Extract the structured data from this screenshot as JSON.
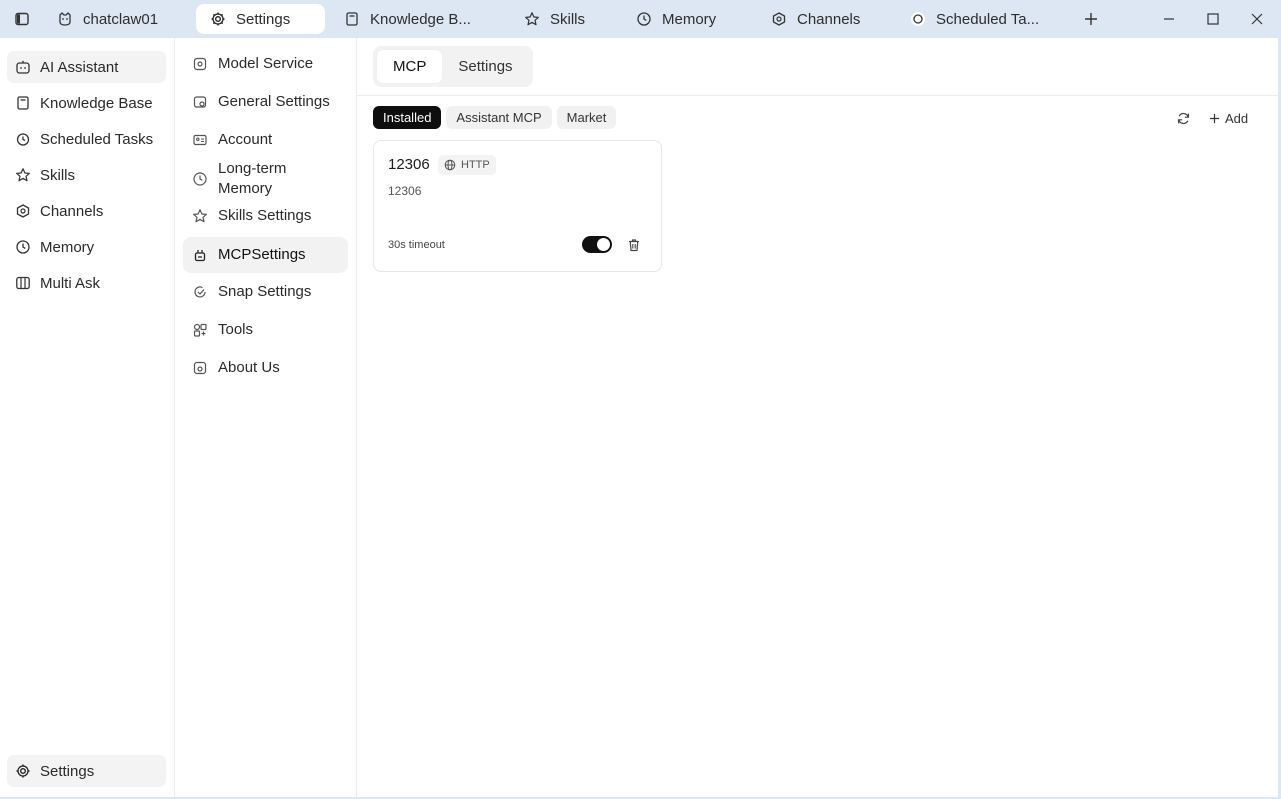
{
  "titlebar": {
    "tabs": [
      {
        "label": "chatclaw01",
        "icon": "cat-icon"
      },
      {
        "label": "Settings",
        "icon": "gear-icon"
      },
      {
        "label": "Knowledge B...",
        "icon": "book-icon"
      },
      {
        "label": "Skills",
        "icon": "star-icon"
      },
      {
        "label": "Memory",
        "icon": "clock-icon"
      },
      {
        "label": "Channels",
        "icon": "channels-icon"
      },
      {
        "label": "Scheduled Ta...",
        "icon": "circle-icon"
      }
    ]
  },
  "sidebar": {
    "items": [
      {
        "label": "AI Assistant"
      },
      {
        "label": "Knowledge Base"
      },
      {
        "label": "Scheduled Tasks"
      },
      {
        "label": "Skills"
      },
      {
        "label": "Channels"
      },
      {
        "label": "Memory"
      },
      {
        "label": "Multi Ask"
      }
    ],
    "footer_label": "Settings"
  },
  "settings_nav": {
    "items": [
      {
        "label": "Model Service"
      },
      {
        "label": "General Settings"
      },
      {
        "label": "Account"
      },
      {
        "label": "Long-term Memory"
      },
      {
        "label": "Skills Settings"
      },
      {
        "label": "MCPSettings"
      },
      {
        "label": "Snap Settings"
      },
      {
        "label": "Tools"
      },
      {
        "label": "About Us"
      }
    ]
  },
  "main": {
    "segments": [
      "MCP",
      "Settings"
    ],
    "filters": [
      "Installed",
      "Assistant MCP",
      "Market"
    ],
    "add_label": "Add",
    "cards": [
      {
        "title": "12306",
        "badge": "HTTP",
        "description": "12306",
        "timeout": "30s timeout",
        "enabled": true
      }
    ]
  }
}
